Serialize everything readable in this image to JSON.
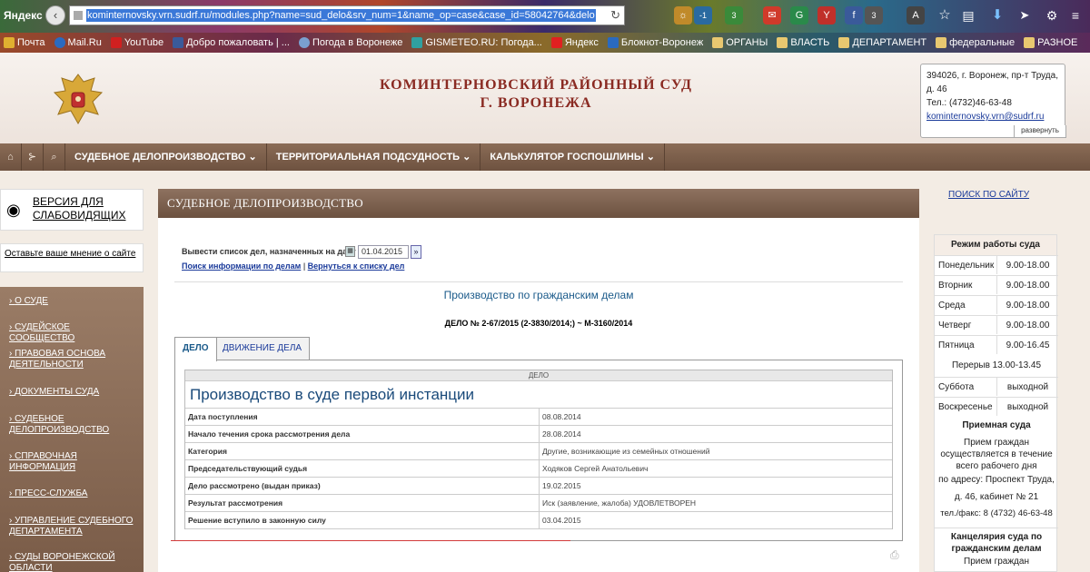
{
  "browser": {
    "app_label": "Яндекс",
    "url": "kominternovsky.vrn.sudrf.ru/modules.php?name=sud_delo&srv_num=1&name_op=case&case_id=58042764&delo",
    "ext_counts": [
      "-1",
      "3",
      "3"
    ],
    "bookmarks": [
      "Почта",
      "Mail.Ru",
      "YouTube",
      "Добро пожаловать | ...",
      "Погода в Воронеже",
      "GISMETEO.RU: Погода...",
      "Яндекс",
      "Блокнот-Воронеж",
      "ОРГАНЫ",
      "ВЛАСТЬ",
      "ДЕПАРТАМЕНТ",
      "федеральные",
      "РАЗНОЕ"
    ]
  },
  "header": {
    "court_line1": "КОМИНТЕРНОВСКИЙ РАЙОННЫЙ СУД",
    "court_line2": "Г. ВОРОНЕЖА",
    "address": "394026, г. Воронеж, пр-т Труда, д. 46",
    "phone": "Тел.: (4732)46-63-48",
    "email": "kominternovsky.vrn@sudrf.ru",
    "expand": "развернуть"
  },
  "nav": {
    "items": [
      "СУДЕБНОЕ ДЕЛОПРОИЗВОДСТВО ⌄",
      "ТЕРРИТОРИАЛЬНАЯ ПОДСУДНОСТЬ ⌄",
      "КАЛЬКУЛЯТОР ГОСПОШЛИНЫ ⌄"
    ]
  },
  "sidebar": {
    "vision": "ВЕРСИЯ ДЛЯ СЛАБОВИДЯЩИХ",
    "feedback": "Оставьте ваше мнение о сайте",
    "menu": [
      "О СУДЕ",
      "СУДЕЙСКОЕ СООБЩЕСТВО",
      "ПРАВОВАЯ ОСНОВА ДЕЯТЕЛЬНОСТИ",
      "ДОКУМЕНТЫ СУДА",
      "СУДЕБНОЕ ДЕЛОПРОИЗВОДСТВО",
      "СПРАВОЧНАЯ ИНФОРМАЦИЯ",
      "ПРЕСС-СЛУЖБА",
      "УПРАВЛЕНИЕ СУДЕБНОГО ДЕПАРТАМЕНТА",
      "СУДЫ ВОРОНЕЖСКОЙ ОБЛАСТИ"
    ]
  },
  "main": {
    "title": "СУДЕБНОЕ ДЕЛОПРОИЗВОДСТВО",
    "date_label": "Вывести список дел, назначенных на дату",
    "date_value": "01.04.2015",
    "search_link": "Поиск информации по делам",
    "separator": "|",
    "back_link": "Вернуться к списку дел",
    "section": "Производство по гражданским делам",
    "case_number": "ДЕЛО № 2-67/2015 (2-3830/2014;) ~ М-3160/2014",
    "tab_case": "ДЕЛО",
    "tab_movement": "ДВИЖЕНИЕ ДЕЛА",
    "table_head": "ДЕЛО",
    "instance": "Производство в суде первой инстанции",
    "rows": [
      {
        "k": "Дата поступления",
        "v": "08.08.2014"
      },
      {
        "k": "Начало течения срока рассмотрения дела",
        "v": "28.08.2014"
      },
      {
        "k": "Категория",
        "v": "Другие, возникающие из семейных отношений"
      },
      {
        "k": "Председательствующий судья",
        "v": "Ходяков Сергей Анатольевич"
      },
      {
        "k": "Дело рассмотрено (выдан приказ)",
        "v": "19.02.2015"
      },
      {
        "k": "Результат рассмотрения",
        "v": "Иск (заявление, жалоба) УДОВЛЕТВОРЕН"
      },
      {
        "k": "Решение вступило в законную силу",
        "v": "03.04.2015"
      }
    ]
  },
  "right": {
    "search": "ПОИСК ПО САЙТУ",
    "hours_title": "Режим работы суда",
    "days": [
      {
        "d": "Понедельник",
        "t": "9.00-18.00"
      },
      {
        "d": "Вторник",
        "t": "9.00-18.00"
      },
      {
        "d": "Среда",
        "t": "9.00-18.00"
      },
      {
        "d": "Четверг",
        "t": "9.00-18.00"
      },
      {
        "d": "Пятница",
        "t": "9.00-16.45"
      }
    ],
    "break": "Перерыв 13.00-13.45",
    "weekend": [
      {
        "d": "Суббота",
        "t": "выходной"
      },
      {
        "d": "Воскресенье",
        "t": "выходной"
      }
    ],
    "reception_title": "Приемная суда",
    "reception_text1": "Прием граждан осуществляется в течение всего рабочего дня",
    "reception_text2": "по адресу: Проспект Труда,",
    "reception_text3": "д. 46, кабинет № 21",
    "reception_text4": "тел./факс: 8 (4732) 46-63-48",
    "office_title": "Канцелярия суда по гражданским делам",
    "office_text": "Прием граждан"
  }
}
